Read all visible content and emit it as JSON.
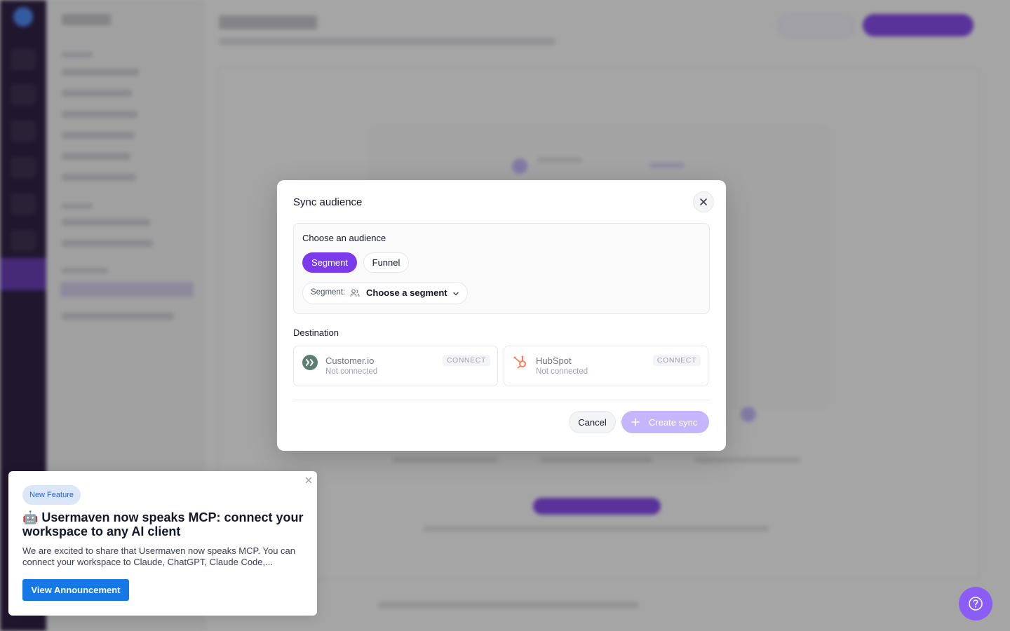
{
  "modal": {
    "title": "Sync audience",
    "audience": {
      "heading": "Choose an audience",
      "tabs": [
        {
          "label": "Segment",
          "active": true
        },
        {
          "label": "Funnel",
          "active": false
        }
      ],
      "segment_label": "Segment:",
      "segment_value": "Choose a segment"
    },
    "destination": {
      "heading": "Destination",
      "items": [
        {
          "name": "Customer.io",
          "status": "Not connected",
          "action": "CONNECT",
          "icon": "customerio-logo-icon"
        },
        {
          "name": "HubSpot",
          "status": "Not connected",
          "action": "CONNECT",
          "icon": "hubspot-logo-icon"
        }
      ]
    },
    "cancel_label": "Cancel",
    "create_label": "Create sync"
  },
  "announcement": {
    "badge": "New Feature",
    "title": "🤖 Usermaven now speaks MCP: connect your workspace to any AI client",
    "body": "We are excited to share that Usermaven now speaks MCP. You can connect your workspace to Claude, ChatGPT, Claude Code,...",
    "button": "View Announcement"
  },
  "colors": {
    "accent": "#7c3aed",
    "accent_disabled": "#c4b5fd",
    "announcement_button": "#1677e6",
    "help_fab": "#8b5cf6"
  }
}
